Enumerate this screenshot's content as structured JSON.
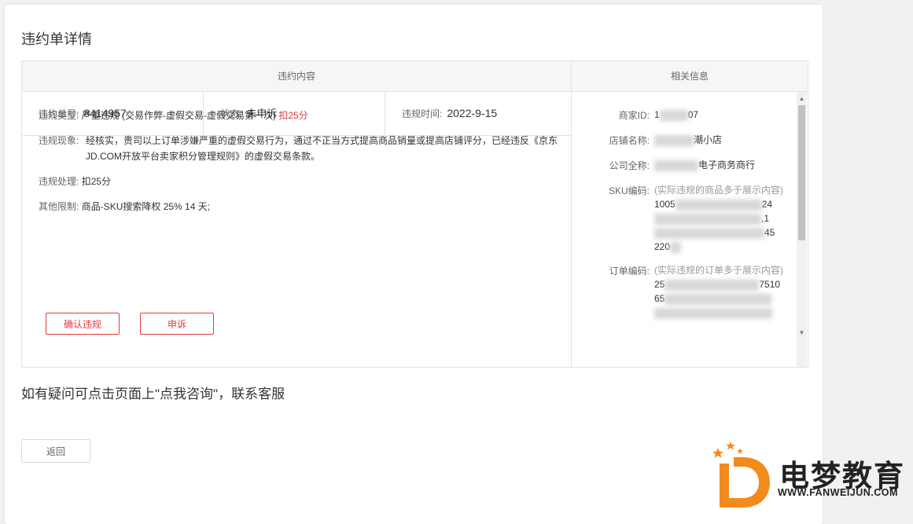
{
  "page": {
    "title": "违约单详情"
  },
  "headers": {
    "left": "违约内容",
    "right": "相关信息"
  },
  "summary": {
    "order_no_label": "违约单号:",
    "order_no": "8414957",
    "status_label": "状态:",
    "status": "未申诉",
    "time_label": "违规时间:",
    "time": "2022-9-15"
  },
  "details": {
    "type_label": "违规类型:",
    "type_value": "严重违规 (交易作弊-虚假交易-虚假交易第一次)",
    "type_penalty": "扣25分",
    "phenomenon_label": "违规现象:",
    "phenomenon_value": "经核实，贵司以上订单涉嫌严重的虚假交易行为，通过不正当方式提高商品销量或提高店铺评分，已经违反《京东JD.COM开放平台卖家积分管理规则》的虚假交易条款。",
    "handling_label": "违规处理:",
    "handling_value": "扣25分",
    "other_label": "其他限制:",
    "other_value": "商品-SKU搜索降权 25% 14 天;"
  },
  "actions": {
    "confirm": "确认违规",
    "appeal": "申诉",
    "back": "返回"
  },
  "info": {
    "merchant_id_label": "商家ID:",
    "merchant_id_prefix": "1",
    "merchant_id_suffix": "07",
    "store_label": "店铺名称:",
    "store_suffix": "潮小店",
    "company_label": "公司全称:",
    "company_suffix": "电子商务商行",
    "sku_label": "SKU编码:",
    "sku_note": "(实际违规的商品多于展示内容)",
    "sku_line1_prefix": "1005",
    "sku_line1_suffix": "24",
    "sku_line2_suffix": ",1",
    "sku_line3_suffix": "45",
    "sku_line4_prefix": "220",
    "order_label": "订单编码:",
    "order_note": "(实际违规的订单多于展示内容)",
    "order_line1_prefix": "25",
    "order_line1_suffix": "7510",
    "order_line2_prefix": "65"
  },
  "help_text": "如有疑问可点击页面上\"点我咨询\"，联系客服",
  "watermark": {
    "name": "电梦教育",
    "url": "WWW.FANWEIJUN.COM"
  },
  "colors": {
    "accent_red": "#e4393c",
    "watermark_orange": "#f28a1e"
  }
}
